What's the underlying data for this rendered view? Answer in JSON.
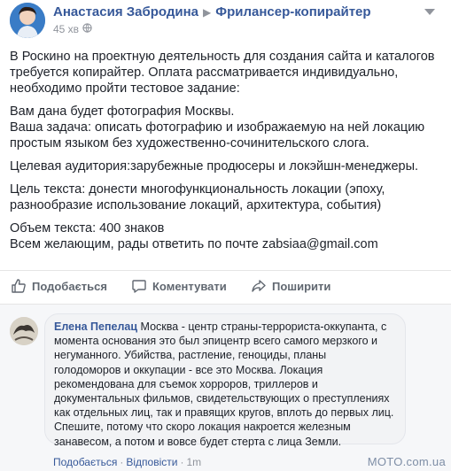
{
  "header": {
    "author": "Анастасия Забродина",
    "group": "Фрилансер-копирайтер",
    "time": "45 хв"
  },
  "post": {
    "p1": "В Роскино на проектную деятельность для создания сайта и каталогов требуется копирайтер. Оплата рассматривается индивидуально, необходимо пройти тестовое задание:",
    "p2": "Вам дана будет фотография Москвы.\nВаша задача: описать фотографию и изображаемую на ней локацию простым языком без художественно-сочинительского слога.",
    "p3": "Целевая аудитория:зарубежные продюсеры и локэйшн-менеджеры.",
    "p4": "Цель текста: донести многофункциональность локации (эпоху, разнообразие использование локаций, архитектура, события)",
    "p5": "Объем текста: 400 знаков\nВсем желающим, рады ответить по почте zabsiaa@gmail.com"
  },
  "actions": {
    "like": "Подобається",
    "comment": "Коментувати",
    "share": "Поширити"
  },
  "comment": {
    "author": "Елена Пепелац",
    "text": "Москва - центр страны-террориста-оккупанта, с момента основания это был эпицентр всего самого мерзкого и негуманного. Убийства, растление, геноциды, планы голодоморов и оккупации - все это Москва. Локация рекомендована для съемок хорроров, триллеров и документальных фильмов, свидетельствующих о преступлениях как отдельных лиц, так и правящих кругов, вплоть до первых лиц. Спешите, потому что скоро локация накроется железным занавесом, а потом и вовсе будет стерта с лица Земли.",
    "like": "Подобається",
    "reply": "Відповісти",
    "time": "1m"
  },
  "watermark": "MOTO.com.ua",
  "colors": {
    "link": "#365899",
    "meta": "#90949c",
    "action": "#606770"
  }
}
